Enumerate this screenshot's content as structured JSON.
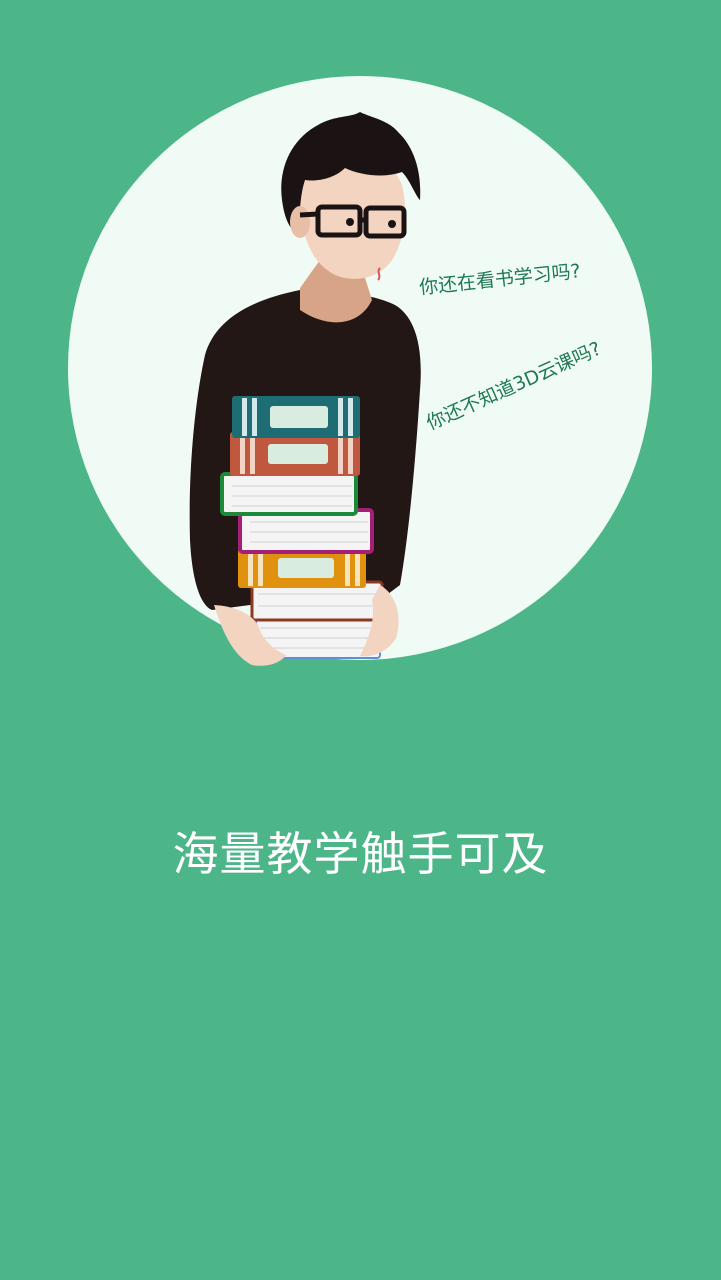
{
  "intro": {
    "speech_1": "你还在看书学习吗?",
    "speech_2": "你还不知道3D云课吗?",
    "slogan": "海量教学触手可及"
  },
  "colors": {
    "background": "#4db689",
    "circle": "#f1fbf6",
    "speech_text": "#1f7a52",
    "slogan_text": "#ffffff"
  }
}
